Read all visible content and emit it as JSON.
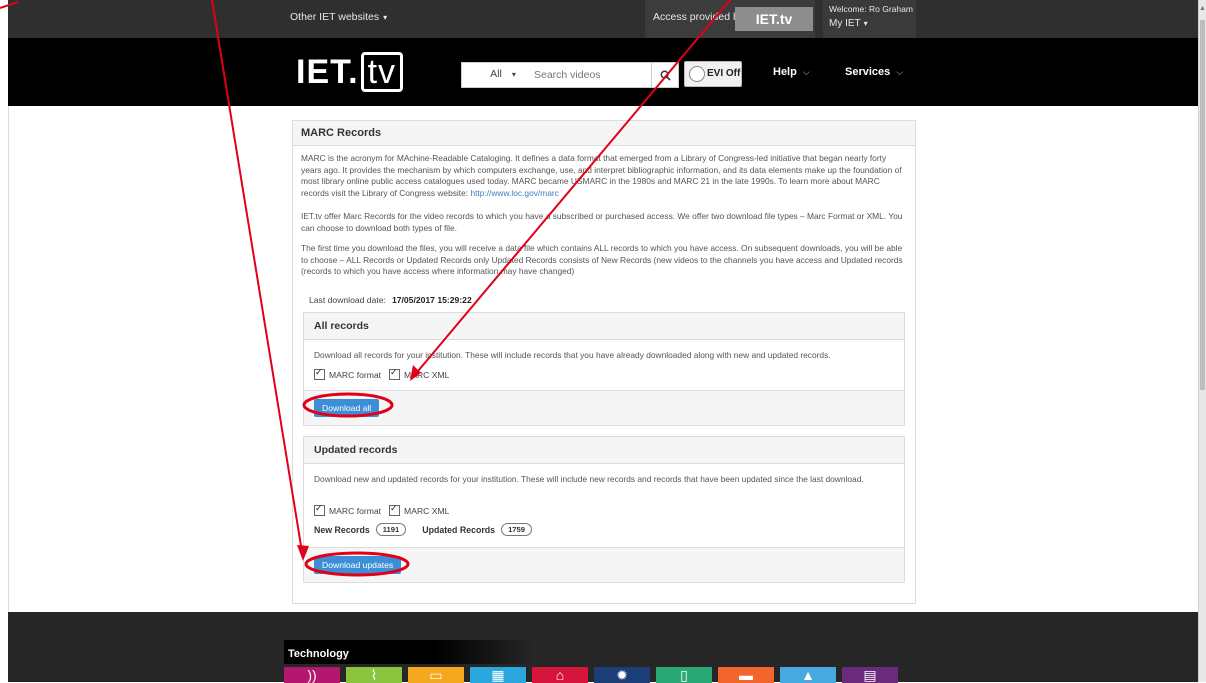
{
  "topbar": {
    "other_sites": "Other IET websites",
    "access_text": "Access provided by",
    "access_logo": "IET.tv",
    "welcome": "Welcome: Ro Graham",
    "my_iet": "My IET"
  },
  "header": {
    "logo_iet": "IET.",
    "logo_tv": "tv",
    "search_category": "All",
    "search_placeholder": "Search videos",
    "evi_label": "EVI Off",
    "help": "Help",
    "services": "Services"
  },
  "marc": {
    "title": "MARC Records",
    "para1_text": "MARC is the acronym for MAchine-Readable Cataloging. It defines a data format that emerged from a Library of Congress-led initiative that began nearly forty years ago. It provides the mechanism by which computers exchange, use, and interpret bibliographic information, and its data elements make up the foundation of most library online public access catalogues used today. MARC became USMARC in the 1980s and MARC 21 in the late 1990s. To learn more about MARC records visit the Library of Congress website: ",
    "para1_link": "http://www.loc.gov/marc",
    "para2": "IET.tv offer Marc Records for the video records to which you have a subscribed or purchased access. We offer two download file types – Marc Format or XML. You can choose to download both types of file.",
    "para3": "The first time you download the files, you will receive a data file which contains ALL records to which you have access. On subsequent downloads, you will be able to choose – ALL Records or Updated Records only Updated Records consists of New Records (new videos to the channels you have access and Updated records (records to which you have access where information may have changed)",
    "last_download_label": "Last download date:",
    "last_download_value": "17/05/2017 15:29:22"
  },
  "all_records": {
    "title": "All records",
    "text": "Download all records for your institution. These will include records that you have already downloaded along with new and updated records.",
    "marc_format": "MARC format",
    "marc_xml": "MARC XML",
    "button": "Download all"
  },
  "updated_records": {
    "title": "Updated records",
    "text": "Download new and updated records for your institution. These will include new records and records that have been updated since the last download.",
    "marc_format": "MARC format",
    "marc_xml": "MARC XML",
    "new_label": "New Records",
    "new_count": "1191",
    "updated_label": "Updated Records",
    "updated_count": "1759",
    "button": "Download updates"
  },
  "footer": {
    "technology": "Technology",
    "tiles": [
      {
        "icon": "rss-icon",
        "color": "#b4176e"
      },
      {
        "icon": "leaf-icon",
        "color": "#8bc53f"
      },
      {
        "icon": "screen-icon",
        "color": "#f4a81d"
      },
      {
        "icon": "chip-icon",
        "color": "#2aa7dc"
      },
      {
        "icon": "house-icon",
        "color": "#d6143c"
      },
      {
        "icon": "gear-icon",
        "color": "#1b3e78"
      },
      {
        "icon": "battery-icon",
        "color": "#2aa876"
      },
      {
        "icon": "car-icon",
        "color": "#f2652c"
      },
      {
        "icon": "plane-icon",
        "color": "#47a9df"
      },
      {
        "icon": "film-icon",
        "color": "#6b2b7d"
      }
    ]
  },
  "colors": {
    "annotation": "#e0001a",
    "button": "#3c8fd6"
  }
}
